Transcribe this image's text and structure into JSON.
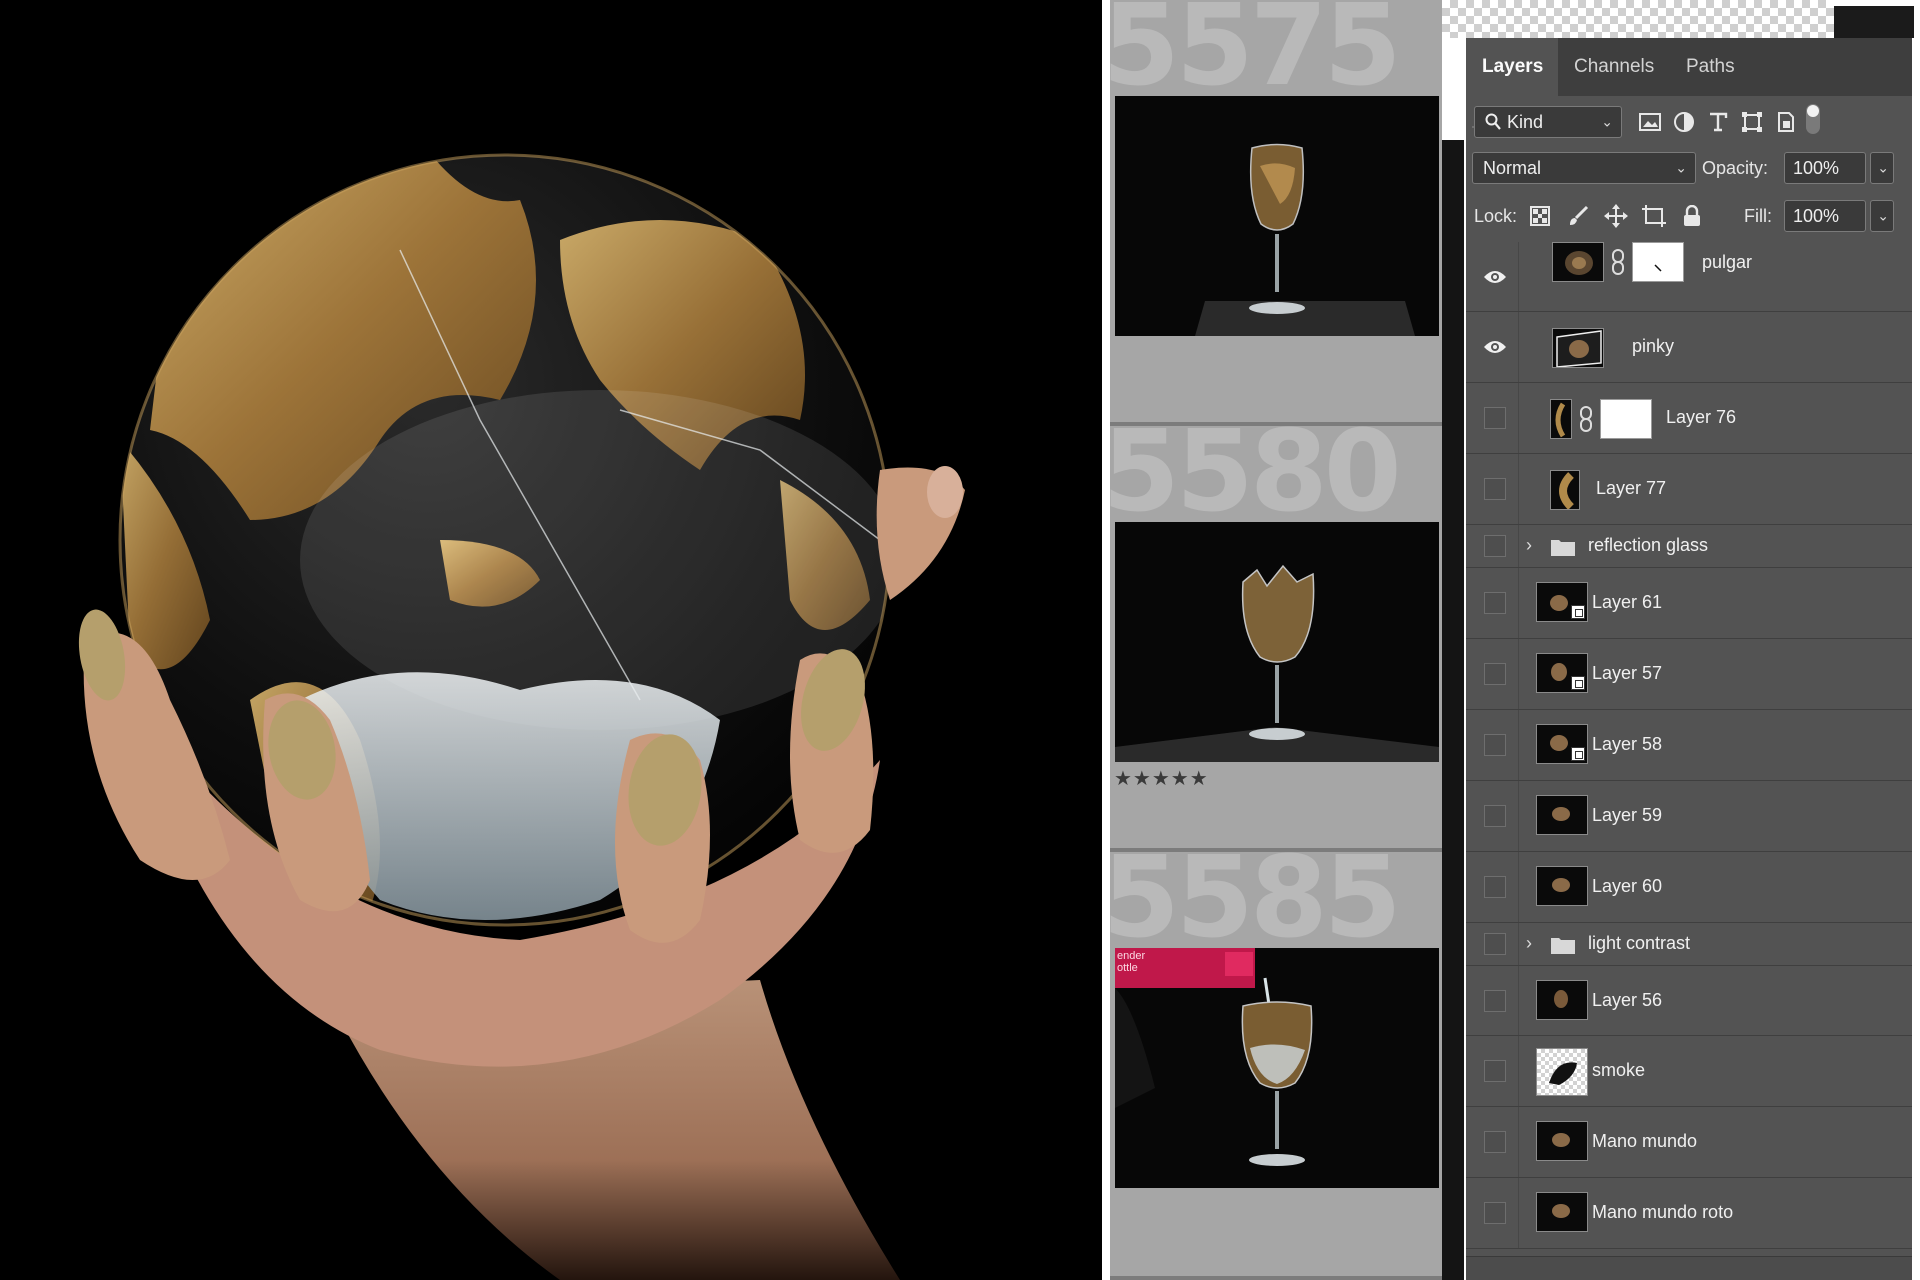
{
  "filmstrip": {
    "frames": [
      {
        "number": "5575",
        "rating": ""
      },
      {
        "number": "5580",
        "rating": "★★★★★"
      },
      {
        "number": "5585",
        "rating": ""
      }
    ],
    "bottle_label": "ender\nottle"
  },
  "layers_panel": {
    "tabs": [
      "Layers",
      "Channels",
      "Paths"
    ],
    "active_tab": "Layers",
    "filter": {
      "label": "Kind"
    },
    "blend_mode": "Normal",
    "opacity_label": "Opacity:",
    "opacity_value": "100%",
    "lock_label": "Lock:",
    "fill_label": "Fill:",
    "fill_value": "100%",
    "layers": [
      {
        "name": "pulgar",
        "visible": true,
        "type": "pixel",
        "mask": true
      },
      {
        "name": "pinky",
        "visible": true,
        "type": "pixel",
        "mask": false
      },
      {
        "name": "Layer 76",
        "visible": false,
        "type": "pixel",
        "mask": true
      },
      {
        "name": "Layer 77",
        "visible": false,
        "type": "pixel",
        "mask": false
      },
      {
        "name": "reflection glass",
        "visible": false,
        "type": "group",
        "mask": false
      },
      {
        "name": "Layer 61",
        "visible": false,
        "type": "smart",
        "mask": false
      },
      {
        "name": "Layer 57",
        "visible": false,
        "type": "smart",
        "mask": false
      },
      {
        "name": "Layer 58",
        "visible": false,
        "type": "smart",
        "mask": false
      },
      {
        "name": "Layer 59",
        "visible": false,
        "type": "pixel",
        "mask": false
      },
      {
        "name": "Layer 60",
        "visible": false,
        "type": "pixel",
        "mask": false
      },
      {
        "name": "light contrast",
        "visible": false,
        "type": "group",
        "mask": false
      },
      {
        "name": "Layer 56",
        "visible": false,
        "type": "pixel",
        "mask": false
      },
      {
        "name": "smoke",
        "visible": false,
        "type": "transparent",
        "mask": false
      },
      {
        "name": "Mano mundo",
        "visible": false,
        "type": "pixel",
        "mask": false
      },
      {
        "name": "Mano mundo roto",
        "visible": false,
        "type": "pixel",
        "mask": false
      }
    ]
  },
  "colors": {
    "panel_bg": "#535353",
    "tab_bar": "#3e3e3e",
    "gold": "#b08a4a",
    "nail": "#b59f6c",
    "skin": "#c99a7c"
  }
}
